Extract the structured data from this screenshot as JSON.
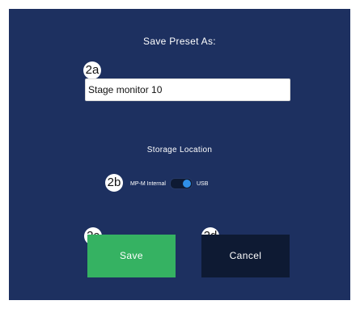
{
  "dialog": {
    "title": "Save Preset As:",
    "name_input": {
      "value": "Stage monitor 10",
      "marker": "2a"
    },
    "storage": {
      "label": "Storage Location",
      "marker": "2b",
      "option_left": "MP-M Internal",
      "option_right": "USB",
      "selected": "USB"
    },
    "save_button": {
      "label": "Save",
      "marker": "2c"
    },
    "cancel_button": {
      "label": "Cancel",
      "marker": "2d"
    }
  },
  "colors": {
    "background": "#1d3060",
    "save": "#35b262",
    "cancel": "#0e1a33",
    "toggle_knob": "#2f8fe8"
  }
}
